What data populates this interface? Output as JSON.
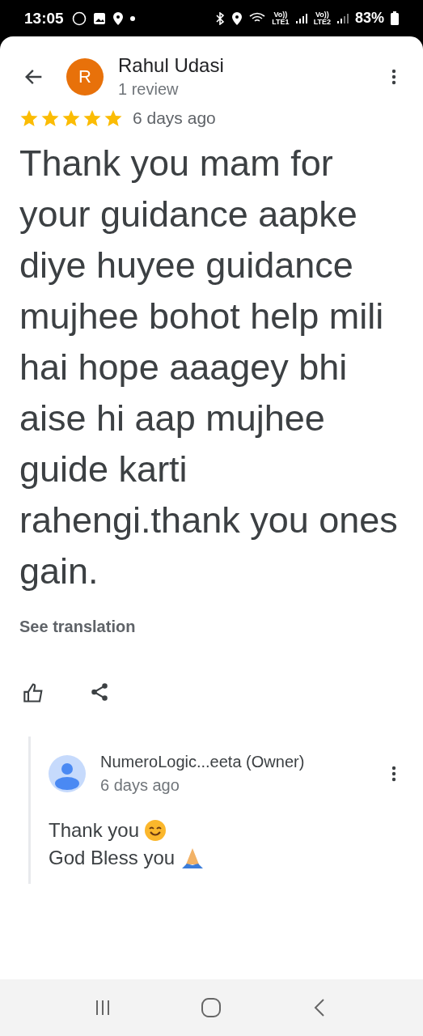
{
  "status_bar": {
    "time": "13:05",
    "volte_1": "Vo))",
    "network_1": "LTE1",
    "volte_2": "Vo))",
    "network_2": "LTE2",
    "battery": "83%"
  },
  "review": {
    "author": "Rahul Udasi",
    "avatar_letter": "R",
    "review_count": "1 review",
    "stars": 5,
    "time": "6 days ago",
    "text": "Thank you mam for your guidance aapke diye huyee guidance mujhee bohot help mili hai hope aaagey bhi aise hi aap mujhee guide karti rahengi.thank you ones gain.",
    "translate_link": "See translation"
  },
  "owner_reply": {
    "author": "NumeroLogic...eeta (Owner)",
    "time": "6 days ago",
    "lines": [
      {
        "text": "Thank you",
        "kind": "smile"
      },
      {
        "text": "God Bless you",
        "kind": "pray"
      }
    ]
  }
}
